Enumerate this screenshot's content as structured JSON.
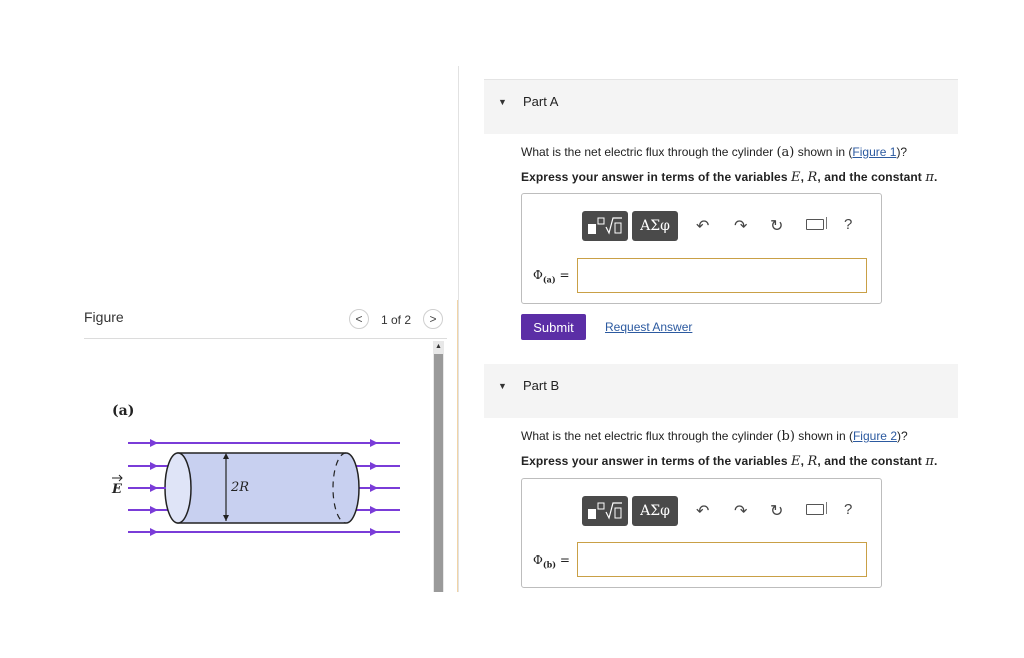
{
  "figure": {
    "title": "Figure",
    "pager_label": "1 of 2",
    "prev_symbol": "<",
    "next_symbol": ">",
    "panel_label": "(a)",
    "field_label": "E",
    "diameter_label": "2R",
    "colors": {
      "field_lines": "#7a3cd8",
      "cylinder_fill": "#c8d0f0",
      "cylinder_stroke": "#222222"
    }
  },
  "partA": {
    "title": "Part A",
    "question_pre": "What is the net electric flux through the cylinder ",
    "question_var": "(a)",
    "question_mid": " shown in (",
    "question_link": "Figure 1",
    "question_post": ")?",
    "instruction_pre": "Express your answer in terms of the variables ",
    "var_E": "E",
    "var_R": "R",
    "instruction_mid": ", and the constant ",
    "var_pi": "π",
    "instruction_post": ".",
    "phi_symbol": "Φ",
    "phi_sub": "(a)",
    "equals": "=",
    "input_value": ""
  },
  "partB": {
    "title": "Part B",
    "question_pre": "What is the net electric flux through the cylinder ",
    "question_var": "(b)",
    "question_mid": " shown in (",
    "question_link": "Figure 2",
    "question_post": ")?",
    "instruction_pre": "Express your answer in terms of the variables ",
    "var_E": "E",
    "var_R": "R",
    "instruction_mid": ", and the constant ",
    "var_pi": "π",
    "instruction_post": ".",
    "phi_symbol": "Φ",
    "phi_sub": "(b)",
    "equals": "=",
    "input_value": ""
  },
  "toolbar": {
    "greek_label": "ΑΣφ",
    "templates_icon": "templates-icon",
    "undo_icon": "undo-icon",
    "redo_icon": "redo-icon",
    "reset_icon": "reset-icon",
    "keyboard_icon": "keyboard-icon",
    "help_label": "?"
  },
  "actions": {
    "submit_label": "Submit",
    "request_label": "Request Answer",
    "submit_color": "#5b2ea6"
  }
}
